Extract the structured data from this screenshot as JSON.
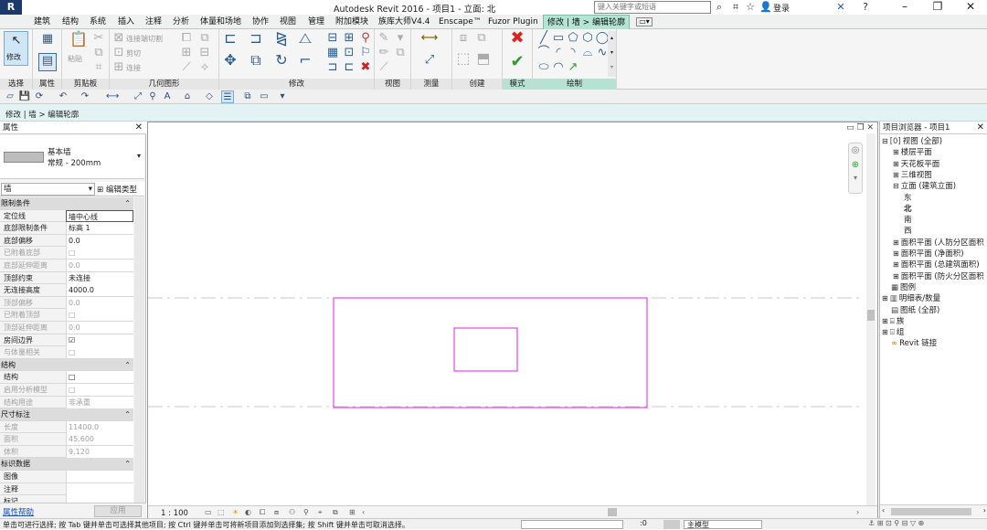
{
  "window": {
    "title": "Autodesk Revit 2016 -    项目1 - 立面: 北",
    "search_placeholder": "键入关键字或短语",
    "login": "登录",
    "logo": "R"
  },
  "ribbon_tabs": [
    "建筑",
    "结构",
    "系统",
    "插入",
    "注释",
    "分析",
    "体量和场地",
    "协作",
    "视图",
    "管理",
    "附加模块",
    "族库大师V4.4",
    "Enscape™",
    "Fuzor Plugin",
    "修改 | 墙 > 编辑轮廓"
  ],
  "ribbon_panels": {
    "select": "选择",
    "properties": "属性",
    "clipboard": "剪贴板",
    "geometry": "几何图形",
    "modify": "修改",
    "view": "视图",
    "measure": "测量",
    "create": "创建",
    "mode": "模式",
    "draw": "绘制",
    "modify_btn": "修改",
    "paste": "粘贴",
    "connect_end_cut": "连接端切割",
    "cut": "剪切",
    "join": "连接"
  },
  "options_bar": {
    "text": "修改 | 墙 > 编辑轮廓"
  },
  "properties": {
    "title": "属性",
    "type_family": "基本墙",
    "type_name": "常规 - 200mm",
    "instance_filter": "墙",
    "edit_type": "编辑类型",
    "rows": [
      {
        "kind": "section",
        "label": "限制条件"
      },
      {
        "kind": "row",
        "label": "定位线",
        "value": "墙中心线",
        "hl": true
      },
      {
        "kind": "row",
        "label": "底部限制条件",
        "value": "标高 1"
      },
      {
        "kind": "row",
        "label": "底部偏移",
        "value": "0.0"
      },
      {
        "kind": "row",
        "label": "已附着底部",
        "check": "□",
        "dis": true
      },
      {
        "kind": "row",
        "label": "底部延伸距离",
        "value": "0.0",
        "dis": true
      },
      {
        "kind": "row",
        "label": "顶部约束",
        "value": "未连接"
      },
      {
        "kind": "row",
        "label": "无连接高度",
        "value": "4000.0"
      },
      {
        "kind": "row",
        "label": "顶部偏移",
        "value": "0.0",
        "dis": true
      },
      {
        "kind": "row",
        "label": "已附着顶部",
        "check": "□",
        "dis": true
      },
      {
        "kind": "row",
        "label": "顶部延伸距离",
        "value": "0.0",
        "dis": true
      },
      {
        "kind": "row",
        "label": "房间边界",
        "check": "☑"
      },
      {
        "kind": "row",
        "label": "与体量相关",
        "check": "□",
        "dis": true
      },
      {
        "kind": "section",
        "label": "结构"
      },
      {
        "kind": "row",
        "label": "结构",
        "check": "□"
      },
      {
        "kind": "row",
        "label": "启用分析模型",
        "check": "□",
        "dis": true
      },
      {
        "kind": "row",
        "label": "结构用途",
        "value": "非承重",
        "dis": true
      },
      {
        "kind": "section",
        "label": "尺寸标注"
      },
      {
        "kind": "row",
        "label": "长度",
        "value": "11400.0",
        "dis": true
      },
      {
        "kind": "row",
        "label": "面积",
        "value": "45.600",
        "dis": true
      },
      {
        "kind": "row",
        "label": "体积",
        "value": "9.120",
        "dis": true
      },
      {
        "kind": "section",
        "label": "标识数据"
      },
      {
        "kind": "row",
        "label": "图像",
        "value": ""
      },
      {
        "kind": "row",
        "label": "注释",
        "value": ""
      },
      {
        "kind": "row",
        "label": "标记",
        "value": ""
      }
    ],
    "help_link": "属性帮助",
    "apply": "应用"
  },
  "view": {
    "scale": "1 : 100",
    "outline_color": "#e020e0",
    "grid_color": "#c8c8c8"
  },
  "project_browser": {
    "title": "项目浏览器 - 项目1",
    "nodes": [
      {
        "level": 0,
        "exp": "⊟",
        "icon": "[0]",
        "label": "视图 (全部)"
      },
      {
        "level": 1,
        "exp": "⊞",
        "label": "楼层平面"
      },
      {
        "level": 1,
        "exp": "⊞",
        "label": "天花板平面"
      },
      {
        "level": 1,
        "exp": "⊞",
        "label": "三维视图"
      },
      {
        "level": 1,
        "exp": "⊟",
        "label": "立面 (建筑立面)"
      },
      {
        "level": 2,
        "label": "东"
      },
      {
        "level": 2,
        "label": "北",
        "bold": true
      },
      {
        "level": 2,
        "label": "南"
      },
      {
        "level": 2,
        "label": "西"
      },
      {
        "level": 1,
        "exp": "⊞",
        "label": "面积平面 (人防分区面积"
      },
      {
        "level": 1,
        "exp": "⊞",
        "label": "面积平面 (净面积)"
      },
      {
        "level": 1,
        "exp": "⊞",
        "label": "面积平面 (总建筑面积)"
      },
      {
        "level": 1,
        "exp": "⊞",
        "label": "面积平面 (防火分区面积"
      },
      {
        "level": 0,
        "icon": "▦",
        "label": "图例"
      },
      {
        "level": 0,
        "exp": "⊞",
        "icon": "▥",
        "label": "明细表/数量"
      },
      {
        "level": 0,
        "icon": "▤",
        "label": "图纸 (全部)"
      },
      {
        "level": 0,
        "exp": "⊞",
        "icon": "⌸",
        "label": "族"
      },
      {
        "level": 0,
        "exp": "⊞",
        "icon": "⌹",
        "label": "组"
      },
      {
        "level": 0,
        "icon": "∞",
        "label": "Revit 链接"
      }
    ]
  },
  "status_bar": {
    "text": "单击可进行选择; 按 Tab 键并单击可选择其他项目; 按 Ctrl 键并单击可将新项目添加到选择集; 按 Shift 键并单击可取消选择。",
    "zero": ":0",
    "model": "主模型"
  }
}
